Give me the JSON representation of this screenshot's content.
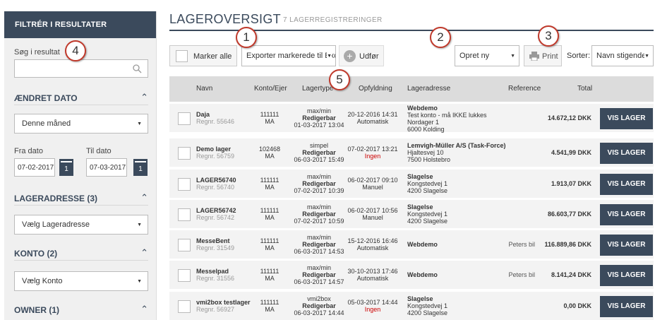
{
  "sidebar": {
    "header": "FILTRÉR I RESULTATER",
    "search_label": "Søg i resultat",
    "search_value": "",
    "section_changed_date": "ÆNDRET DATO",
    "date_period": "Denne måned",
    "from_label": "Fra dato",
    "from_value": "07-02-2017",
    "to_label": "Til dato",
    "to_value": "07-03-2017",
    "calendar_day": "1",
    "section_address": "LAGERADRESSE (3)",
    "address_select": "Vælg Lageradresse",
    "section_account": "KONTO (2)",
    "account_select": "Vælg Konto",
    "section_owner": "OWNER (1)",
    "chevron": "^"
  },
  "header": {
    "title": "LAGEROVERSIGT",
    "subtitle": "7 LAGERREGISTRERINGER"
  },
  "toolbar": {
    "select_all": "Marker alle",
    "export_select": "Exporter markerede til Excel",
    "execute": "Udfør",
    "create_new": "Opret ny",
    "print": "Print",
    "sort_label": "Sorter:",
    "sort_value": "Navn stigende"
  },
  "columns": [
    "Navn",
    "Konto/Ejer",
    "Lagertype",
    "Opfyldning",
    "Lageradresse",
    "Reference",
    "Total"
  ],
  "rows": [
    {
      "name": "Daja",
      "reg": "Regnr. 55646",
      "account": "111111",
      "owner": "MA",
      "type": "max/min",
      "editable": "Redigerbar",
      "type_date": "01-03-2017 13:04",
      "fill_date": "20-12-2016 14:31",
      "fill_mode": "Automatisk",
      "address": [
        "Webdemo",
        "Test konto - må IKKE lukkes",
        "Nordager 1",
        "6000 Kolding"
      ],
      "reference": "",
      "total": "14.672,12 DKK",
      "action": "VIS LAGER"
    },
    {
      "name": "Demo lager",
      "reg": "Regnr. 56759",
      "account": "102468",
      "owner": "MA",
      "type": "simpel",
      "editable": "Redigerbar",
      "type_date": "06-03-2017 15:49",
      "fill_date": "07-02-2017 13:21",
      "fill_mode": "Ingen",
      "address": [
        "Lemvigh-Müller A/S (Task-Force)",
        "Hjaltesvej 10",
        "7500 Holstebro"
      ],
      "reference": "",
      "total": "4.541,99 DKK",
      "action": "VIS LAGER"
    },
    {
      "name": "LAGER56740",
      "reg": "Regnr. 56740",
      "account": "111111",
      "owner": "MA",
      "type": "max/min",
      "editable": "Redigerbar",
      "type_date": "07-02-2017 10:39",
      "fill_date": "06-02-2017 09:10",
      "fill_mode": "Manuel",
      "address": [
        "Slagelse",
        "Kongstedvej 1",
        "4200 Slagelse"
      ],
      "reference": "",
      "total": "1.913,07 DKK",
      "action": "VIS LAGER"
    },
    {
      "name": "LAGER56742",
      "reg": "Regnr. 56742",
      "account": "111111",
      "owner": "MA",
      "type": "max/min",
      "editable": "Redigerbar",
      "type_date": "07-02-2017 10:59",
      "fill_date": "06-02-2017 10:56",
      "fill_mode": "Manuel",
      "address": [
        "Slagelse",
        "Kongstedvej 1",
        "4200 Slagelse"
      ],
      "reference": "",
      "total": "86.603,77 DKK",
      "action": "VIS LAGER"
    },
    {
      "name": "MesseBent",
      "reg": "Regnr. 31549",
      "account": "111111",
      "owner": "MA",
      "type": "max/min",
      "editable": "Redigerbar",
      "type_date": "06-03-2017 14:53",
      "fill_date": "15-12-2016 16:46",
      "fill_mode": "Automatisk",
      "address": [
        "Webdemo"
      ],
      "reference": "Peters bil",
      "total": "116.889,86 DKK",
      "action": "VIS LAGER"
    },
    {
      "name": "Messelpad",
      "reg": "Regnr. 31556",
      "account": "111111",
      "owner": "MA",
      "type": "max/min",
      "editable": "Redigerbar",
      "type_date": "06-03-2017 14:57",
      "fill_date": "30-10-2013 17:46",
      "fill_mode": "Automatisk",
      "address": [
        "Webdemo"
      ],
      "reference": "Peters bil",
      "total": "8.141,24 DKK",
      "action": "VIS LAGER"
    },
    {
      "name": "vmi2box testlager",
      "reg": "Regnr. 56927",
      "account": "111111",
      "owner": "MA",
      "type": "vmi2box",
      "editable": "Redigerbar",
      "type_date": "06-03-2017 14:44",
      "fill_date": "05-03-2017 14:44",
      "fill_mode": "Ingen",
      "address": [
        "Slagelse",
        "Kongstedvej 1",
        "4200 Slagelse"
      ],
      "reference": "",
      "total": "0,00 DKK",
      "action": "VIS LAGER"
    }
  ],
  "annotations": [
    "1",
    "2",
    "3",
    "4",
    "5"
  ],
  "colors": {
    "accent": "#3b4a5c",
    "row": "#f3f3f3",
    "header": "#dcdcdc",
    "marker": "#c0392b",
    "none": "#cc0000"
  }
}
